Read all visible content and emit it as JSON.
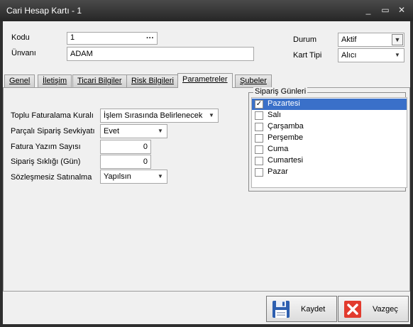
{
  "window": {
    "title": "Cari Hesap Kartı - 1",
    "minimize_glyph": "_",
    "restore_glyph": "▭",
    "close_glyph": "✕"
  },
  "header": {
    "kodu_label": "Kodu",
    "kodu_value": "1",
    "kodu_lookup_glyph": "···",
    "unvani_label": "Ünvanı",
    "unvani_value": "ADAM",
    "durum_label": "Durum",
    "durum_value": "Aktif",
    "kart_tipi_label": "Kart Tipi",
    "kart_tipi_value": "Alıcı"
  },
  "tabs": [
    {
      "label": "Genel"
    },
    {
      "label": "İletişim"
    },
    {
      "label": "Ticari Bilgiler"
    },
    {
      "label": "Risk Bilgileri"
    },
    {
      "label": "Parametreler"
    },
    {
      "label": "Şubeler"
    }
  ],
  "active_tab": "Parametreler",
  "parametreler": {
    "toplu_faturalama_label": "Toplu Faturalama Kuralı",
    "toplu_faturalama_value": "İşlem Sırasında Belirlenecek",
    "parcali_siparis_label": "Parçalı Sipariş Sevkiyatı",
    "parcali_siparis_value": "Evet",
    "fatura_yazim_label": "Fatura Yazım Sayısı",
    "fatura_yazim_value": "0",
    "siparis_sikligi_label": "Sipariş Sıklığı (Gün)",
    "siparis_sikligi_value": "0",
    "sozlesmesiz_label": "Sözleşmesiz Satınalma",
    "sozlesmesiz_value": "Yapılsın"
  },
  "siparis_gunleri": {
    "title": "Sipariş Günleri",
    "days": [
      {
        "label": "Pazartesi",
        "checked": true,
        "selected": true
      },
      {
        "label": "Salı",
        "checked": false,
        "selected": false
      },
      {
        "label": "Çarşamba",
        "checked": false,
        "selected": false
      },
      {
        "label": "Perşembe",
        "checked": false,
        "selected": false
      },
      {
        "label": "Cuma",
        "checked": false,
        "selected": false
      },
      {
        "label": "Cumartesi",
        "checked": false,
        "selected": false
      },
      {
        "label": "Pazar",
        "checked": false,
        "selected": false
      }
    ]
  },
  "buttons": {
    "kaydet_label": "Kaydet",
    "vazgec_label": "Vazgeç",
    "kaydet_icon": "floppy-disk-icon",
    "vazgec_icon": "red-x-icon"
  },
  "colors": {
    "selection": "#3a70c9",
    "titlebar": "#2e2e2e",
    "cancel_red": "#e23b2e",
    "save_blue": "#2d5fb0"
  }
}
